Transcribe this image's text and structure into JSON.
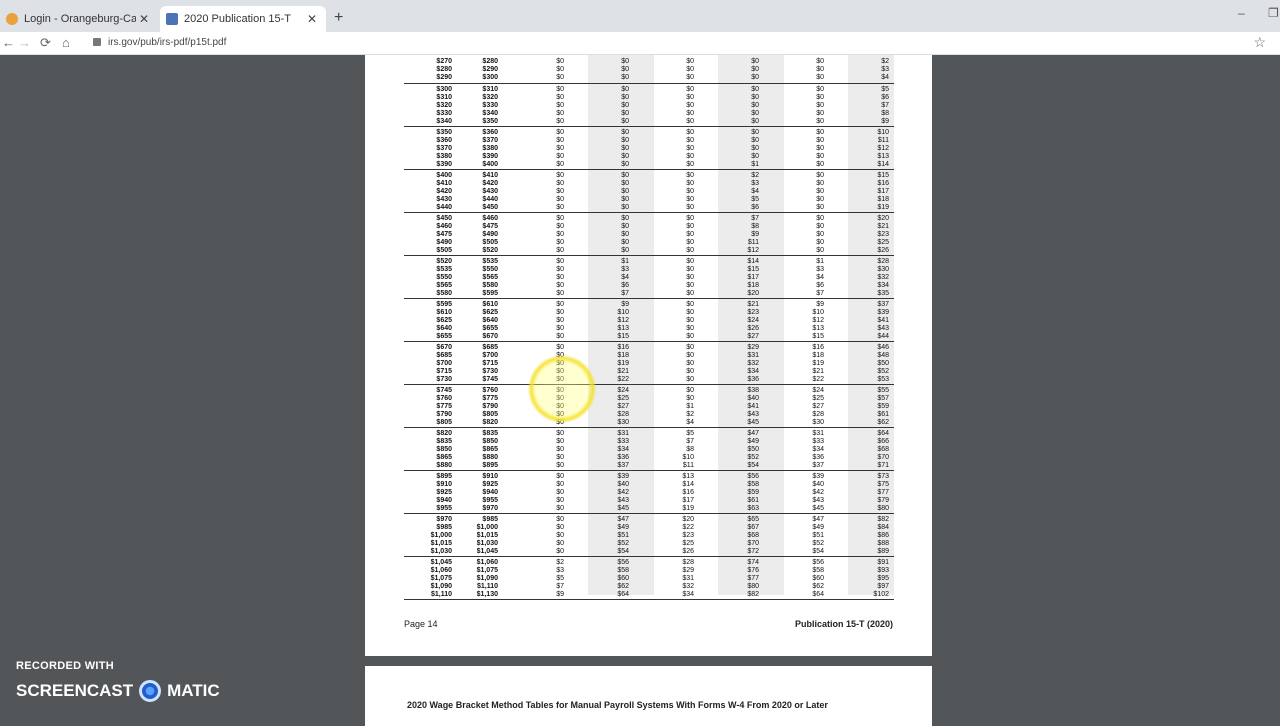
{
  "browser": {
    "tabs": [
      {
        "title": "Login - Orangeburg-Calhoun Te",
        "active": false
      },
      {
        "title": "2020 Publication 15-T",
        "active": true
      }
    ],
    "url": "irs.gov/pub/irs-pdf/p15t.pdf"
  },
  "document": {
    "footer_left": "Page 14",
    "footer_right": "Publication 15-T (2020)",
    "next_page_heading": "2020 Wage Bracket Method Tables for Manual Payroll Systems With Forms W-4 From 2020 or Later",
    "rows": [
      [
        "$270",
        "$280",
        "$0",
        "$0",
        "$0",
        "$0",
        "$0",
        "$2"
      ],
      [
        "$280",
        "$290",
        "$0",
        "$0",
        "$0",
        "$0",
        "$0",
        "$3"
      ],
      [
        "$290",
        "$300",
        "$0",
        "$0",
        "$0",
        "$0",
        "$0",
        "$4"
      ],
      [
        "$300",
        "$310",
        "$0",
        "$0",
        "$0",
        "$0",
        "$0",
        "$5"
      ],
      [
        "$310",
        "$320",
        "$0",
        "$0",
        "$0",
        "$0",
        "$0",
        "$6"
      ],
      [
        "$320",
        "$330",
        "$0",
        "$0",
        "$0",
        "$0",
        "$0",
        "$7"
      ],
      [
        "$330",
        "$340",
        "$0",
        "$0",
        "$0",
        "$0",
        "$0",
        "$8"
      ],
      [
        "$340",
        "$350",
        "$0",
        "$0",
        "$0",
        "$0",
        "$0",
        "$9"
      ],
      [
        "$350",
        "$360",
        "$0",
        "$0",
        "$0",
        "$0",
        "$0",
        "$10"
      ],
      [
        "$360",
        "$370",
        "$0",
        "$0",
        "$0",
        "$0",
        "$0",
        "$11"
      ],
      [
        "$370",
        "$380",
        "$0",
        "$0",
        "$0",
        "$0",
        "$0",
        "$12"
      ],
      [
        "$380",
        "$390",
        "$0",
        "$0",
        "$0",
        "$0",
        "$0",
        "$13"
      ],
      [
        "$390",
        "$400",
        "$0",
        "$0",
        "$0",
        "$1",
        "$0",
        "$14"
      ],
      [
        "$400",
        "$410",
        "$0",
        "$0",
        "$0",
        "$2",
        "$0",
        "$15"
      ],
      [
        "$410",
        "$420",
        "$0",
        "$0",
        "$0",
        "$3",
        "$0",
        "$16"
      ],
      [
        "$420",
        "$430",
        "$0",
        "$0",
        "$0",
        "$4",
        "$0",
        "$17"
      ],
      [
        "$430",
        "$440",
        "$0",
        "$0",
        "$0",
        "$5",
        "$0",
        "$18"
      ],
      [
        "$440",
        "$450",
        "$0",
        "$0",
        "$0",
        "$6",
        "$0",
        "$19"
      ],
      [
        "$450",
        "$460",
        "$0",
        "$0",
        "$0",
        "$7",
        "$0",
        "$20"
      ],
      [
        "$460",
        "$475",
        "$0",
        "$0",
        "$0",
        "$8",
        "$0",
        "$21"
      ],
      [
        "$475",
        "$490",
        "$0",
        "$0",
        "$0",
        "$9",
        "$0",
        "$23"
      ],
      [
        "$490",
        "$505",
        "$0",
        "$0",
        "$0",
        "$11",
        "$0",
        "$25"
      ],
      [
        "$505",
        "$520",
        "$0",
        "$0",
        "$0",
        "$12",
        "$0",
        "$26"
      ],
      [
        "$520",
        "$535",
        "$0",
        "$1",
        "$0",
        "$14",
        "$1",
        "$28"
      ],
      [
        "$535",
        "$550",
        "$0",
        "$3",
        "$0",
        "$15",
        "$3",
        "$30"
      ],
      [
        "$550",
        "$565",
        "$0",
        "$4",
        "$0",
        "$17",
        "$4",
        "$32"
      ],
      [
        "$565",
        "$580",
        "$0",
        "$6",
        "$0",
        "$18",
        "$6",
        "$34"
      ],
      [
        "$580",
        "$595",
        "$0",
        "$7",
        "$0",
        "$20",
        "$7",
        "$35"
      ],
      [
        "$595",
        "$610",
        "$0",
        "$9",
        "$0",
        "$21",
        "$9",
        "$37"
      ],
      [
        "$610",
        "$625",
        "$0",
        "$10",
        "$0",
        "$23",
        "$10",
        "$39"
      ],
      [
        "$625",
        "$640",
        "$0",
        "$12",
        "$0",
        "$24",
        "$12",
        "$41"
      ],
      [
        "$640",
        "$655",
        "$0",
        "$13",
        "$0",
        "$26",
        "$13",
        "$43"
      ],
      [
        "$655",
        "$670",
        "$0",
        "$15",
        "$0",
        "$27",
        "$15",
        "$44"
      ],
      [
        "$670",
        "$685",
        "$0",
        "$16",
        "$0",
        "$29",
        "$16",
        "$46"
      ],
      [
        "$685",
        "$700",
        "$0",
        "$18",
        "$0",
        "$31",
        "$18",
        "$48"
      ],
      [
        "$700",
        "$715",
        "$0",
        "$19",
        "$0",
        "$32",
        "$19",
        "$50"
      ],
      [
        "$715",
        "$730",
        "$0",
        "$21",
        "$0",
        "$34",
        "$21",
        "$52"
      ],
      [
        "$730",
        "$745",
        "$0",
        "$22",
        "$0",
        "$36",
        "$22",
        "$53"
      ],
      [
        "$745",
        "$760",
        "$0",
        "$24",
        "$0",
        "$38",
        "$24",
        "$55"
      ],
      [
        "$760",
        "$775",
        "$0",
        "$25",
        "$0",
        "$40",
        "$25",
        "$57"
      ],
      [
        "$775",
        "$790",
        "$0",
        "$27",
        "$1",
        "$41",
        "$27",
        "$59"
      ],
      [
        "$790",
        "$805",
        "$0",
        "$28",
        "$2",
        "$43",
        "$28",
        "$61"
      ],
      [
        "$805",
        "$820",
        "$0",
        "$30",
        "$4",
        "$45",
        "$30",
        "$62"
      ],
      [
        "$820",
        "$835",
        "$0",
        "$31",
        "$5",
        "$47",
        "$31",
        "$64"
      ],
      [
        "$835",
        "$850",
        "$0",
        "$33",
        "$7",
        "$49",
        "$33",
        "$66"
      ],
      [
        "$850",
        "$865",
        "$0",
        "$34",
        "$8",
        "$50",
        "$34",
        "$68"
      ],
      [
        "$865",
        "$880",
        "$0",
        "$36",
        "$10",
        "$52",
        "$36",
        "$70"
      ],
      [
        "$880",
        "$895",
        "$0",
        "$37",
        "$11",
        "$54",
        "$37",
        "$71"
      ],
      [
        "$895",
        "$910",
        "$0",
        "$39",
        "$13",
        "$56",
        "$39",
        "$73"
      ],
      [
        "$910",
        "$925",
        "$0",
        "$40",
        "$14",
        "$58",
        "$40",
        "$75"
      ],
      [
        "$925",
        "$940",
        "$0",
        "$42",
        "$16",
        "$59",
        "$42",
        "$77"
      ],
      [
        "$940",
        "$955",
        "$0",
        "$43",
        "$17",
        "$61",
        "$43",
        "$79"
      ],
      [
        "$955",
        "$970",
        "$0",
        "$45",
        "$19",
        "$63",
        "$45",
        "$80"
      ],
      [
        "$970",
        "$985",
        "$0",
        "$47",
        "$20",
        "$65",
        "$47",
        "$82"
      ],
      [
        "$985",
        "$1,000",
        "$0",
        "$49",
        "$22",
        "$67",
        "$49",
        "$84"
      ],
      [
        "$1,000",
        "$1,015",
        "$0",
        "$51",
        "$23",
        "$68",
        "$51",
        "$86"
      ],
      [
        "$1,015",
        "$1,030",
        "$0",
        "$52",
        "$25",
        "$70",
        "$52",
        "$88"
      ],
      [
        "$1,030",
        "$1,045",
        "$0",
        "$54",
        "$26",
        "$72",
        "$54",
        "$89"
      ],
      [
        "$1,045",
        "$1,060",
        "$2",
        "$56",
        "$28",
        "$74",
        "$56",
        "$91"
      ],
      [
        "$1,060",
        "$1,075",
        "$3",
        "$58",
        "$29",
        "$76",
        "$58",
        "$93"
      ],
      [
        "$1,075",
        "$1,090",
        "$5",
        "$60",
        "$31",
        "$77",
        "$60",
        "$95"
      ],
      [
        "$1,090",
        "$1,110",
        "$7",
        "$62",
        "$32",
        "$80",
        "$62",
        "$97"
      ],
      [
        "$1,110",
        "$1,130",
        "$9",
        "$64",
        "$34",
        "$82",
        "$64",
        "$102"
      ]
    ]
  },
  "watermark": {
    "line1": "RECORDED WITH",
    "line2_left": "SCREENCAST",
    "line2_right": "MATIC"
  },
  "colors": {
    "page_bg": "#525659",
    "cursor_highlight": "#f5e128"
  }
}
